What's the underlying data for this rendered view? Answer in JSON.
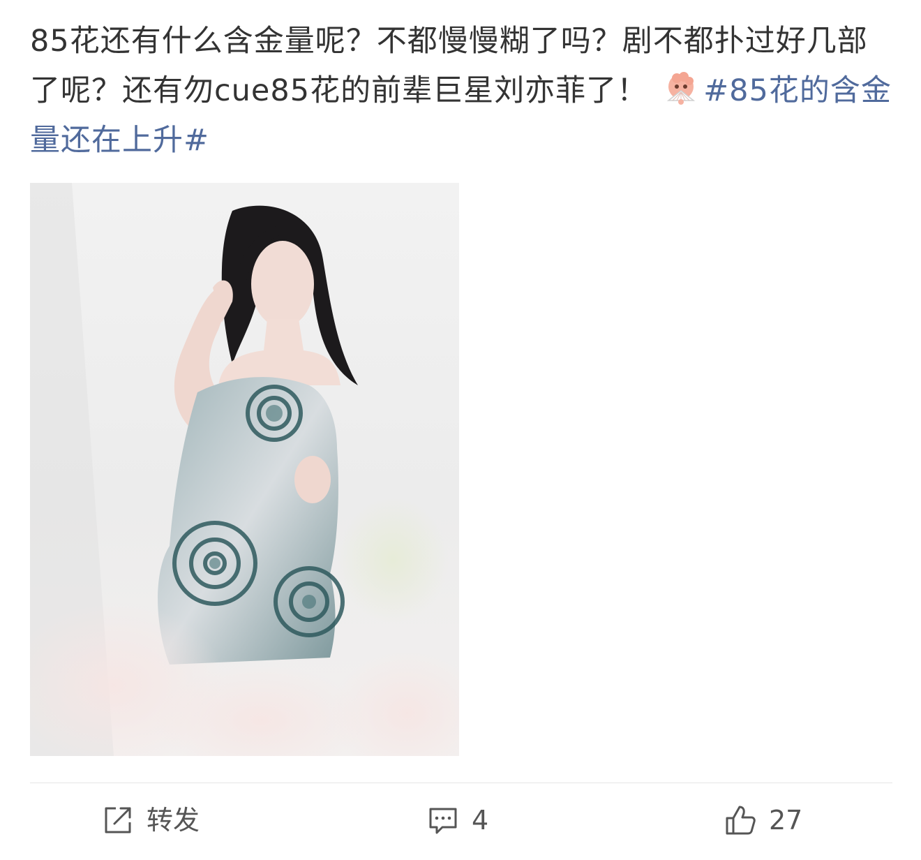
{
  "post": {
    "text_part1": "85花还有什么含金量呢？不都慢慢糊了吗？剧不都扑过好几部了呢？还有勿cue85花的前辈巨星刘亦菲了！",
    "emoji": "fan-emoji",
    "hashtag": "#85花的含金量还在上升#"
  },
  "image": {
    "kind": "photo-woman-metallic-floral-dress"
  },
  "actions": {
    "repost_label": "转发",
    "comment_count": "4",
    "like_count": "27"
  },
  "colors": {
    "text": "#333333",
    "hashtag": "#506a9c",
    "action_text": "#555555",
    "divider": "#e6e6e6"
  }
}
